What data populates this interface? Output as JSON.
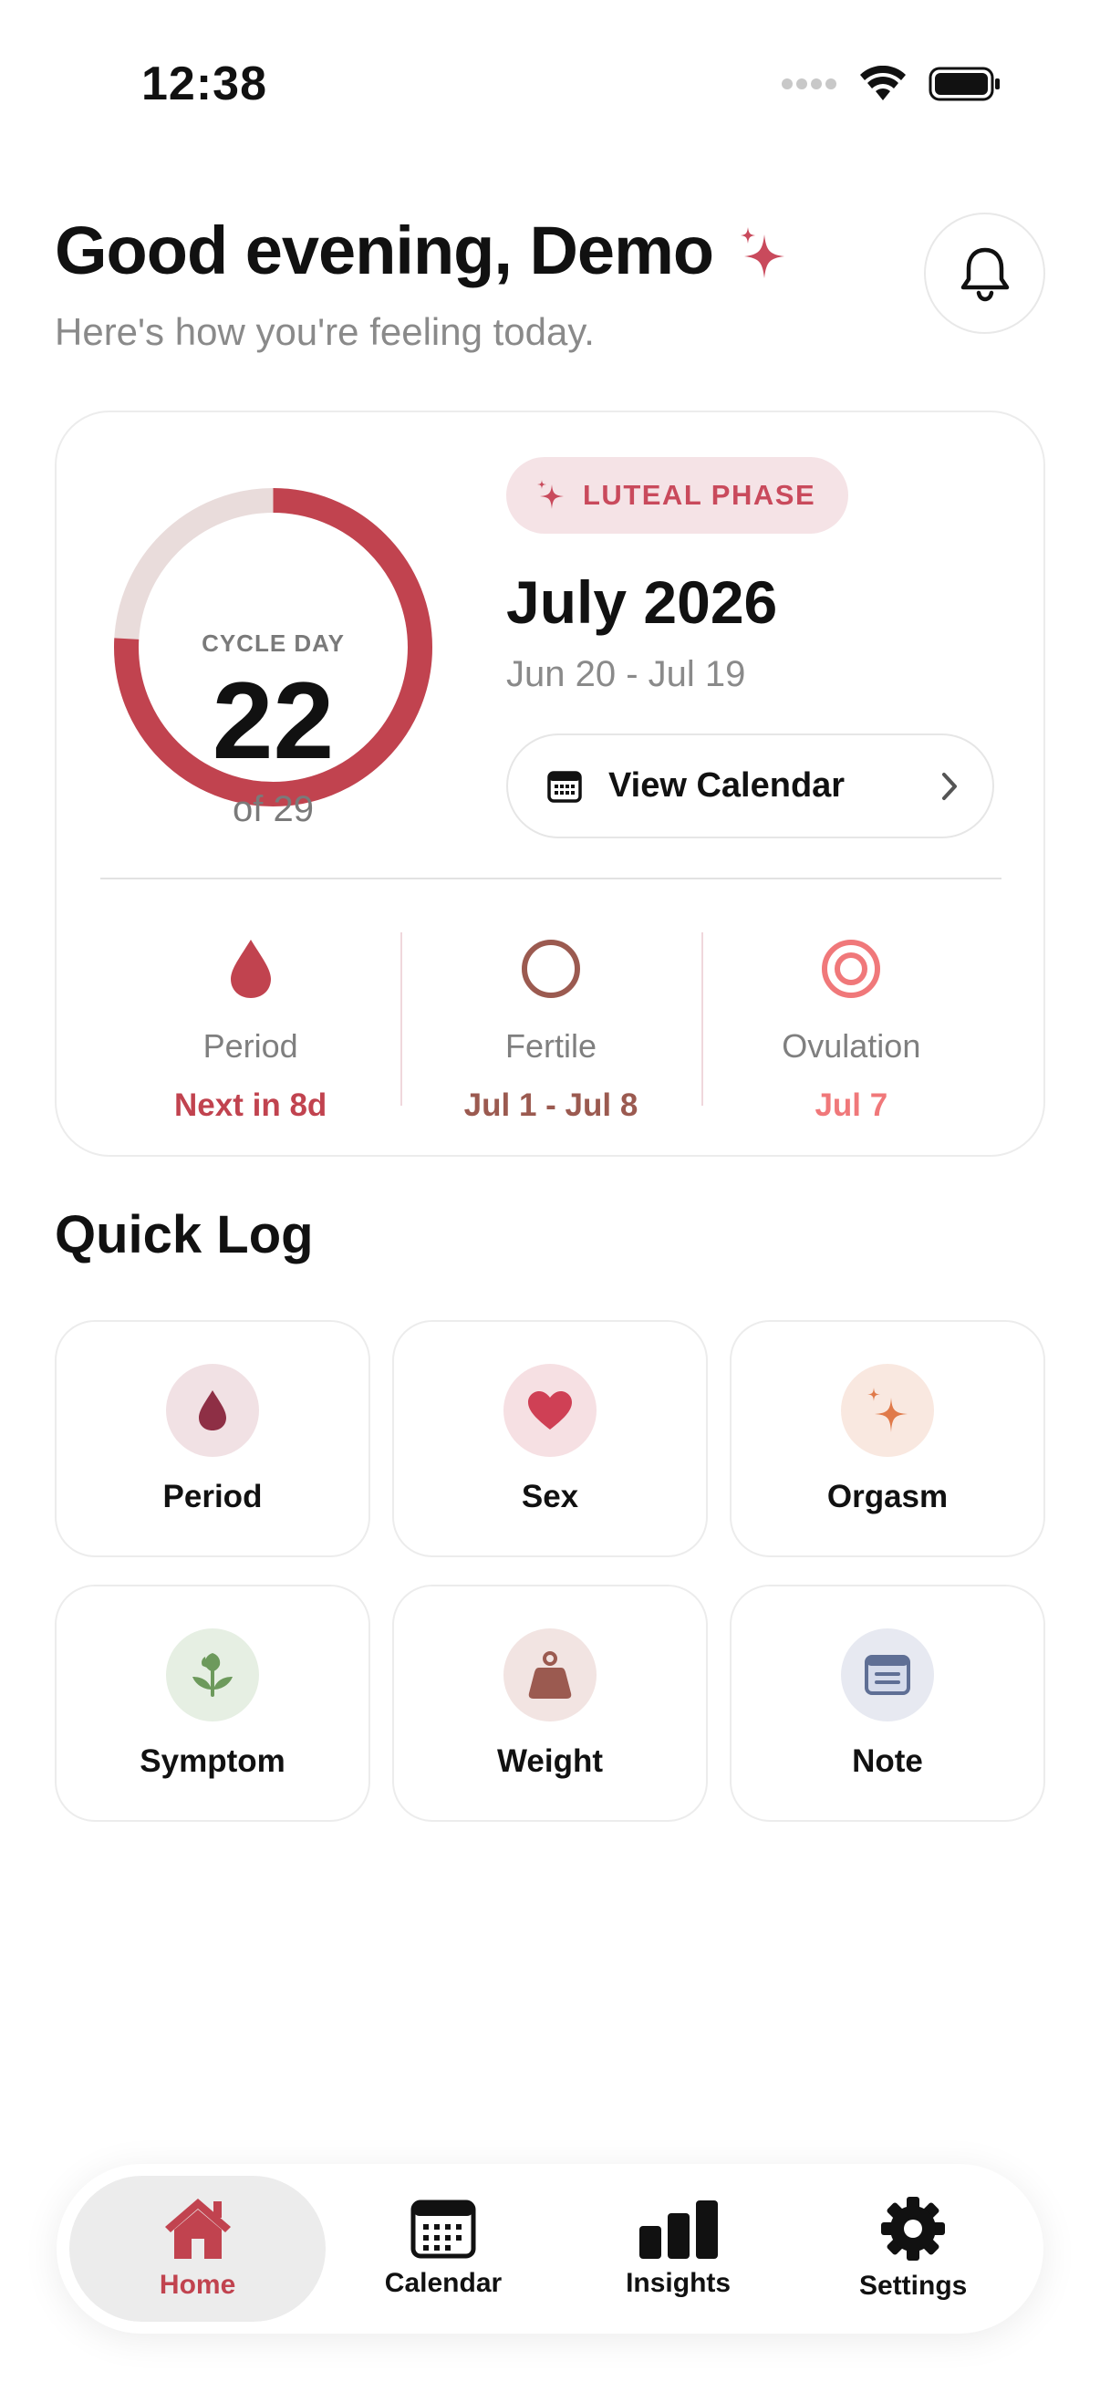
{
  "status_bar": {
    "time": "12:38"
  },
  "header": {
    "greeting": "Good evening, Demo",
    "subtitle": "Here's how you're feeling today."
  },
  "cycle": {
    "label": "CYCLE DAY",
    "day": "22",
    "of_label": "of 29",
    "progress": 0.759,
    "phase": "LUTEAL PHASE",
    "month": "July 2026",
    "range": "Jun 20 - Jul 19",
    "view_calendar_label": "View Calendar",
    "stats": [
      {
        "name": "Period",
        "value": "Next in 8d",
        "color": "#c1434f"
      },
      {
        "name": "Fertile",
        "value": "Jul 1 - Jul 8",
        "color": "#9b5a50"
      },
      {
        "name": "Ovulation",
        "value": "Jul 7",
        "color": "#f0787a"
      }
    ]
  },
  "quick_log": {
    "title": "Quick Log",
    "items": [
      {
        "label": "Period",
        "icon": "drop-icon"
      },
      {
        "label": "Sex",
        "icon": "heart-icon"
      },
      {
        "label": "Orgasm",
        "icon": "sparkle-icon"
      },
      {
        "label": "Symptom",
        "icon": "plant-icon"
      },
      {
        "label": "Weight",
        "icon": "weight-icon"
      },
      {
        "label": "Note",
        "icon": "note-icon"
      }
    ]
  },
  "tabs": [
    {
      "label": "Home",
      "icon": "home-icon",
      "active": true
    },
    {
      "label": "Calendar",
      "icon": "calendar-icon",
      "active": false
    },
    {
      "label": "Insights",
      "icon": "bar-chart-icon",
      "active": false
    },
    {
      "label": "Settings",
      "icon": "gear-icon",
      "active": false
    }
  ],
  "colors": {
    "accent": "#c1434f",
    "ring_track": "#e9dcdb",
    "phase_badge_bg": "#f5e3e6"
  }
}
